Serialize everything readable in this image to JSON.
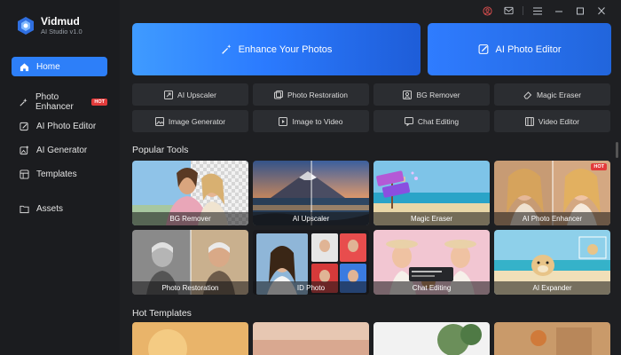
{
  "app": {
    "name": "Vidmud",
    "subtitle": "AI Studio v1.0"
  },
  "topbar": {
    "icons": [
      "account-icon",
      "mail-icon",
      "menu-icon",
      "minimize-icon",
      "maximize-icon",
      "close-icon"
    ]
  },
  "sidebar": {
    "items": [
      {
        "label": "Home",
        "icon": "home-icon",
        "active": true
      },
      {
        "label": "Photo Enhancer",
        "icon": "sparkle-icon",
        "badge": "HOT"
      },
      {
        "label": "AI Photo Editor",
        "icon": "edit-icon"
      },
      {
        "label": "AI Generator",
        "icon": "generate-icon"
      },
      {
        "label": "Templates",
        "icon": "templates-icon"
      },
      {
        "label": "Assets",
        "icon": "folder-icon"
      }
    ]
  },
  "hero": {
    "enhance_label": "Enhance Your Photos",
    "editor_label": "AI Photo Editor"
  },
  "tools": [
    {
      "label": "AI Upscaler",
      "icon": "upscale-icon"
    },
    {
      "label": "Photo Restoration",
      "icon": "restore-icon"
    },
    {
      "label": "BG Remover",
      "icon": "bg-remove-icon"
    },
    {
      "label": "Magic Eraser",
      "icon": "eraser-icon"
    },
    {
      "label": "Image Generator",
      "icon": "image-gen-icon"
    },
    {
      "label": "Image to Video",
      "icon": "video-icon"
    },
    {
      "label": "Chat Editing",
      "icon": "chat-icon"
    },
    {
      "label": "Video Editor",
      "icon": "film-icon"
    }
  ],
  "popular": {
    "title": "Popular Tools",
    "cards": [
      {
        "label": "BG Remover"
      },
      {
        "label": "AI Upscaler"
      },
      {
        "label": "Magic Eraser"
      },
      {
        "label": "AI Photo Enhancer",
        "badge": "HOT"
      },
      {
        "label": "Photo Restoration"
      },
      {
        "label": "ID Photo"
      },
      {
        "label": "Chat Editing"
      },
      {
        "label": "AI Expander"
      }
    ]
  },
  "templates": {
    "title": "Hot Templates"
  }
}
